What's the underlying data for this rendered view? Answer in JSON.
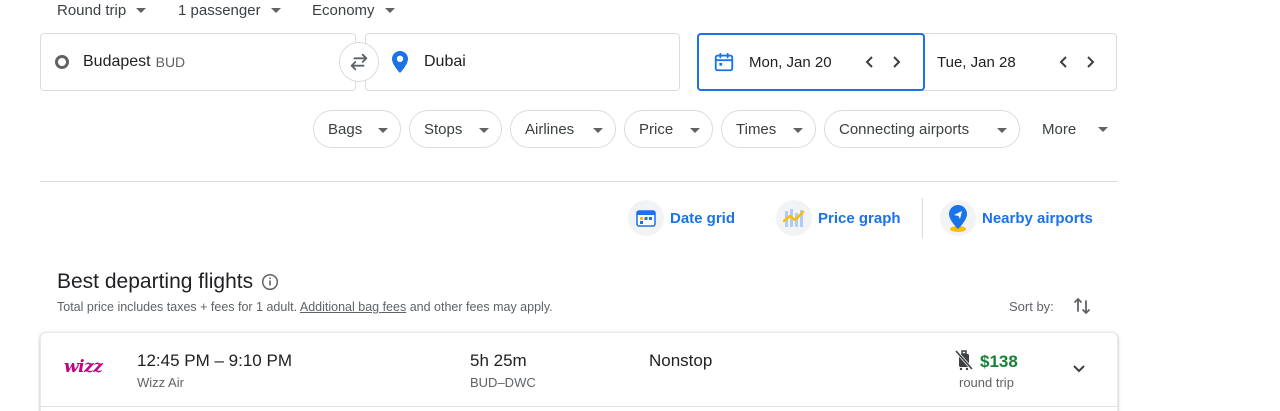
{
  "top_selectors": {
    "trip_type": "Round trip",
    "passengers": "1 passenger",
    "cabin": "Economy"
  },
  "search": {
    "origin_city": "Budapest",
    "origin_code": "BUD",
    "destination": "Dubai",
    "depart_date": "Mon, Jan 20",
    "return_date": "Tue, Jan 28"
  },
  "filters": [
    "Bags",
    "Stops",
    "Airlines",
    "Price",
    "Times",
    "Connecting airports",
    "More"
  ],
  "view_options": {
    "date_grid": "Date grid",
    "price_graph": "Price graph",
    "nearby_airports": "Nearby airports"
  },
  "results": {
    "heading": "Best departing flights",
    "subline_prefix": "Total price includes taxes + fees for 1 adult.",
    "bag_fees_link": "Additional bag fees",
    "subline_suffix": "and other fees may apply.",
    "sort_label": "Sort by:"
  },
  "flights": [
    {
      "airline_logo_text": "wizz",
      "times": "12:45 PM – 9:10 PM",
      "airline": "Wizz Air",
      "duration": "5h 25m",
      "route": "BUD–DWC",
      "stops": "Nonstop",
      "price": "$138",
      "price_note": "round trip"
    }
  ],
  "colors": {
    "accent": "#1a73e8",
    "price_green": "#188038",
    "wizz_brand": "#c6007e"
  }
}
